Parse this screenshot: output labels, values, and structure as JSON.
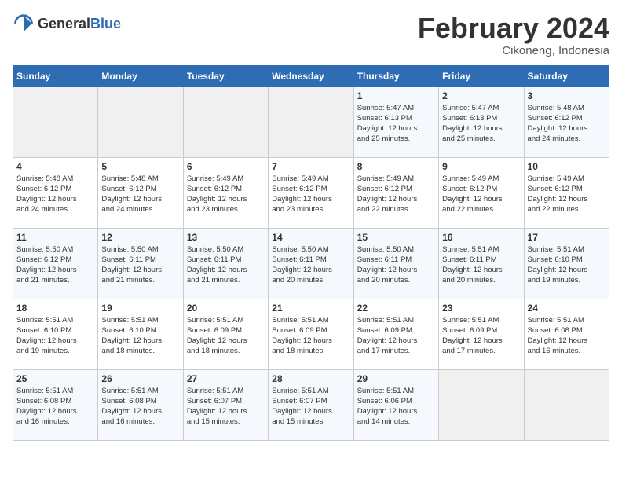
{
  "logo": {
    "general": "General",
    "blue": "Blue"
  },
  "title": "February 2024",
  "subtitle": "Cikoneng, Indonesia",
  "days_of_week": [
    "Sunday",
    "Monday",
    "Tuesday",
    "Wednesday",
    "Thursday",
    "Friday",
    "Saturday"
  ],
  "weeks": [
    [
      {
        "day": "",
        "info": ""
      },
      {
        "day": "",
        "info": ""
      },
      {
        "day": "",
        "info": ""
      },
      {
        "day": "",
        "info": ""
      },
      {
        "day": "1",
        "info": "Sunrise: 5:47 AM\nSunset: 6:13 PM\nDaylight: 12 hours\nand 25 minutes."
      },
      {
        "day": "2",
        "info": "Sunrise: 5:47 AM\nSunset: 6:13 PM\nDaylight: 12 hours\nand 25 minutes."
      },
      {
        "day": "3",
        "info": "Sunrise: 5:48 AM\nSunset: 6:12 PM\nDaylight: 12 hours\nand 24 minutes."
      }
    ],
    [
      {
        "day": "4",
        "info": "Sunrise: 5:48 AM\nSunset: 6:12 PM\nDaylight: 12 hours\nand 24 minutes."
      },
      {
        "day": "5",
        "info": "Sunrise: 5:48 AM\nSunset: 6:12 PM\nDaylight: 12 hours\nand 24 minutes."
      },
      {
        "day": "6",
        "info": "Sunrise: 5:49 AM\nSunset: 6:12 PM\nDaylight: 12 hours\nand 23 minutes."
      },
      {
        "day": "7",
        "info": "Sunrise: 5:49 AM\nSunset: 6:12 PM\nDaylight: 12 hours\nand 23 minutes."
      },
      {
        "day": "8",
        "info": "Sunrise: 5:49 AM\nSunset: 6:12 PM\nDaylight: 12 hours\nand 22 minutes."
      },
      {
        "day": "9",
        "info": "Sunrise: 5:49 AM\nSunset: 6:12 PM\nDaylight: 12 hours\nand 22 minutes."
      },
      {
        "day": "10",
        "info": "Sunrise: 5:49 AM\nSunset: 6:12 PM\nDaylight: 12 hours\nand 22 minutes."
      }
    ],
    [
      {
        "day": "11",
        "info": "Sunrise: 5:50 AM\nSunset: 6:12 PM\nDaylight: 12 hours\nand 21 minutes."
      },
      {
        "day": "12",
        "info": "Sunrise: 5:50 AM\nSunset: 6:11 PM\nDaylight: 12 hours\nand 21 minutes."
      },
      {
        "day": "13",
        "info": "Sunrise: 5:50 AM\nSunset: 6:11 PM\nDaylight: 12 hours\nand 21 minutes."
      },
      {
        "day": "14",
        "info": "Sunrise: 5:50 AM\nSunset: 6:11 PM\nDaylight: 12 hours\nand 20 minutes."
      },
      {
        "day": "15",
        "info": "Sunrise: 5:50 AM\nSunset: 6:11 PM\nDaylight: 12 hours\nand 20 minutes."
      },
      {
        "day": "16",
        "info": "Sunrise: 5:51 AM\nSunset: 6:11 PM\nDaylight: 12 hours\nand 20 minutes."
      },
      {
        "day": "17",
        "info": "Sunrise: 5:51 AM\nSunset: 6:10 PM\nDaylight: 12 hours\nand 19 minutes."
      }
    ],
    [
      {
        "day": "18",
        "info": "Sunrise: 5:51 AM\nSunset: 6:10 PM\nDaylight: 12 hours\nand 19 minutes."
      },
      {
        "day": "19",
        "info": "Sunrise: 5:51 AM\nSunset: 6:10 PM\nDaylight: 12 hours\nand 18 minutes."
      },
      {
        "day": "20",
        "info": "Sunrise: 5:51 AM\nSunset: 6:09 PM\nDaylight: 12 hours\nand 18 minutes."
      },
      {
        "day": "21",
        "info": "Sunrise: 5:51 AM\nSunset: 6:09 PM\nDaylight: 12 hours\nand 18 minutes."
      },
      {
        "day": "22",
        "info": "Sunrise: 5:51 AM\nSunset: 6:09 PM\nDaylight: 12 hours\nand 17 minutes."
      },
      {
        "day": "23",
        "info": "Sunrise: 5:51 AM\nSunset: 6:09 PM\nDaylight: 12 hours\nand 17 minutes."
      },
      {
        "day": "24",
        "info": "Sunrise: 5:51 AM\nSunset: 6:08 PM\nDaylight: 12 hours\nand 16 minutes."
      }
    ],
    [
      {
        "day": "25",
        "info": "Sunrise: 5:51 AM\nSunset: 6:08 PM\nDaylight: 12 hours\nand 16 minutes."
      },
      {
        "day": "26",
        "info": "Sunrise: 5:51 AM\nSunset: 6:08 PM\nDaylight: 12 hours\nand 16 minutes."
      },
      {
        "day": "27",
        "info": "Sunrise: 5:51 AM\nSunset: 6:07 PM\nDaylight: 12 hours\nand 15 minutes."
      },
      {
        "day": "28",
        "info": "Sunrise: 5:51 AM\nSunset: 6:07 PM\nDaylight: 12 hours\nand 15 minutes."
      },
      {
        "day": "29",
        "info": "Sunrise: 5:51 AM\nSunset: 6:06 PM\nDaylight: 12 hours\nand 14 minutes."
      },
      {
        "day": "",
        "info": ""
      },
      {
        "day": "",
        "info": ""
      }
    ]
  ]
}
